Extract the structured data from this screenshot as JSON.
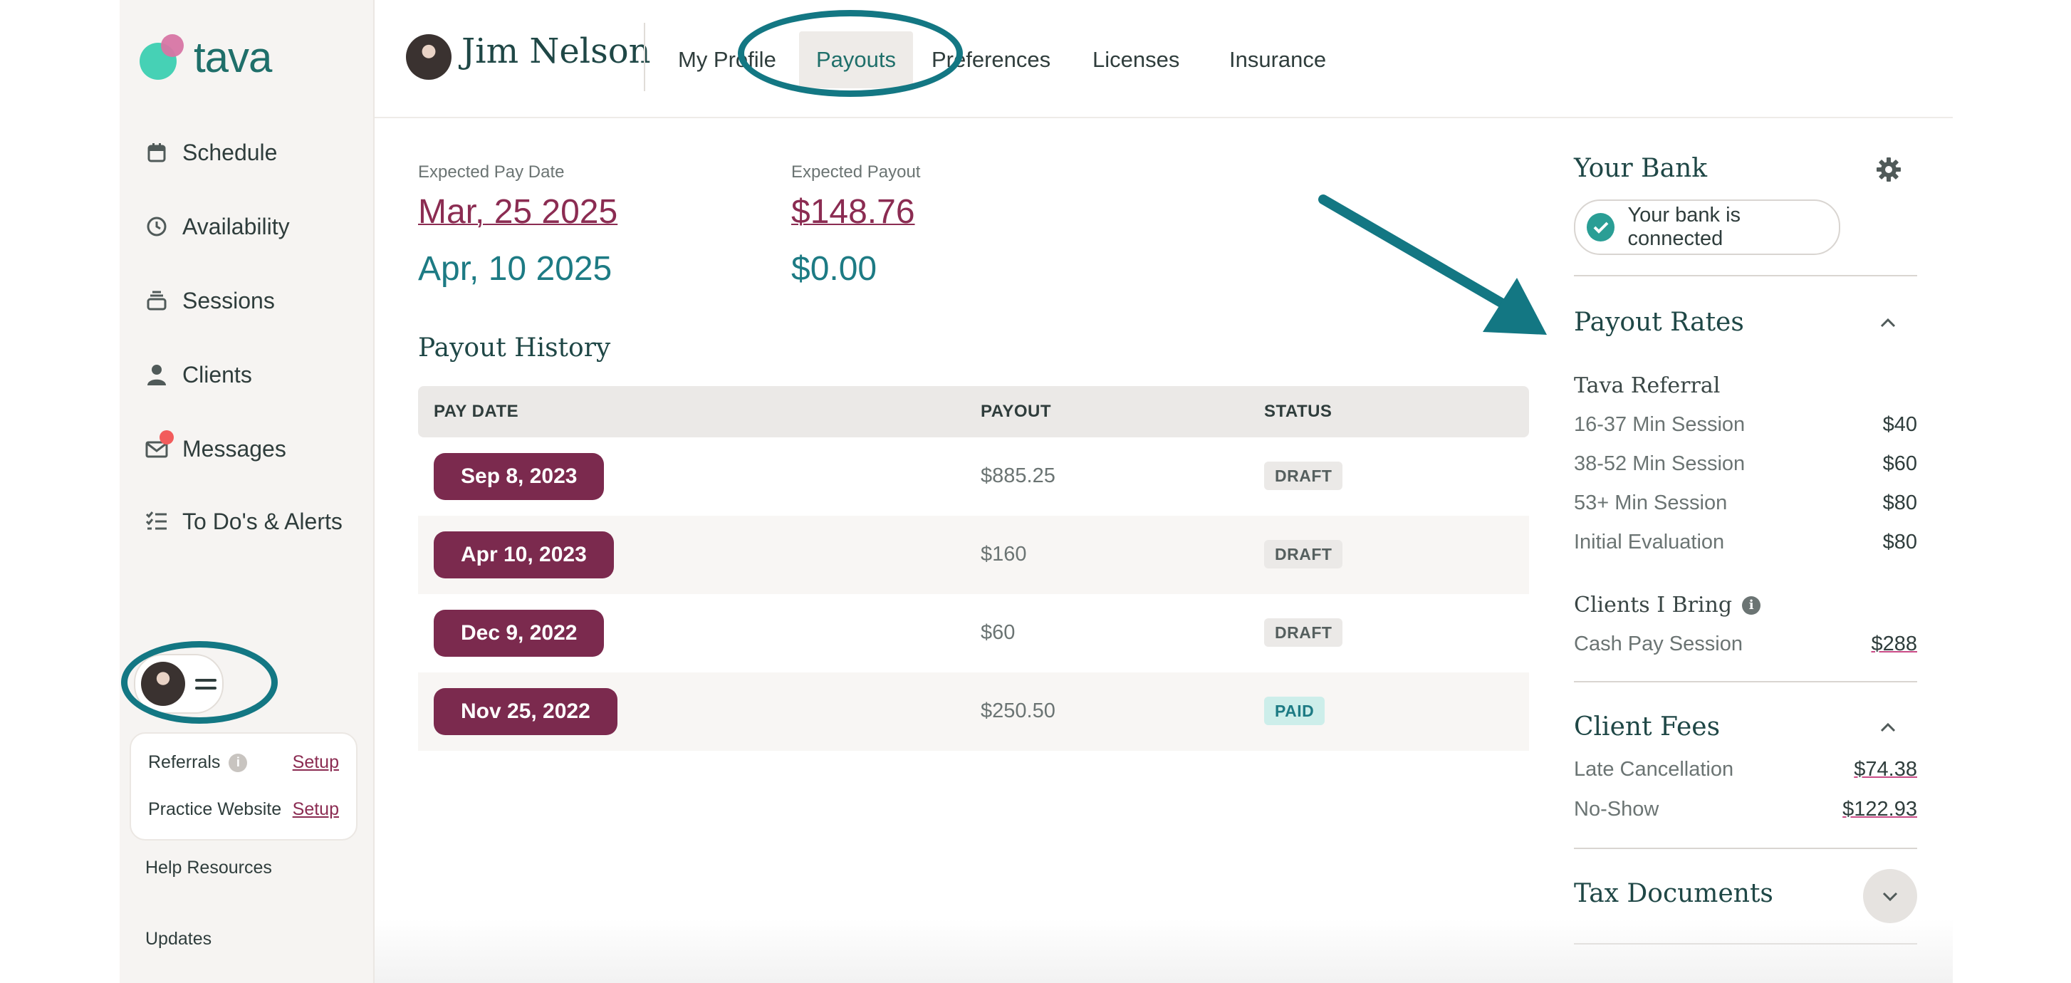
{
  "app": {
    "logo_text": "tava"
  },
  "sidebar": {
    "items": [
      {
        "label": "Schedule",
        "icon": "calendar-icon"
      },
      {
        "label": "Availability",
        "icon": "clock-icon"
      },
      {
        "label": "Sessions",
        "icon": "stack-icon"
      },
      {
        "label": "Clients",
        "icon": "person-icon"
      },
      {
        "label": "Messages",
        "icon": "mail-icon",
        "badge_color": "#f25c5c"
      },
      {
        "label": "To Do's & Alerts",
        "icon": "checklist-icon"
      }
    ],
    "setup": [
      {
        "label": "Referrals",
        "action": "Setup",
        "has_info": true
      },
      {
        "label": "Practice Website",
        "action": "Setup",
        "has_info": false
      }
    ],
    "help": "Help Resources",
    "updates": "Updates"
  },
  "header": {
    "name": "Jim Nelson",
    "tabs": [
      {
        "label": "My Profile",
        "active": false
      },
      {
        "label": "Payouts",
        "active": true
      },
      {
        "label": "Preferences",
        "active": false
      },
      {
        "label": "Licenses",
        "active": false
      },
      {
        "label": "Insurance",
        "active": false
      }
    ]
  },
  "payouts": {
    "date_label": "Expected Pay Date",
    "payout_label": "Expected Payout",
    "upcoming": [
      {
        "date": "Mar, 25 2025",
        "amount": "$148.76"
      },
      {
        "date": "Apr, 10 2025",
        "amount": "$0.00"
      }
    ],
    "history_title": "Payout History",
    "columns": [
      "PAY DATE",
      "PAYOUT",
      "STATUS"
    ],
    "rows": [
      {
        "date": "Sep 8, 2023",
        "amount": "$885.25",
        "status": "DRAFT"
      },
      {
        "date": "Apr 10, 2023",
        "amount": "$160",
        "status": "DRAFT"
      },
      {
        "date": "Dec 9, 2022",
        "amount": "$60",
        "status": "DRAFT"
      },
      {
        "date": "Nov 25, 2022",
        "amount": "$250.50",
        "status": "PAID"
      }
    ]
  },
  "right_panel": {
    "bank_title": "Your Bank",
    "bank_status": "Your bank is connected",
    "rates_title": "Payout Rates",
    "tava_referral_title": "Tava Referral",
    "tava_rates": [
      {
        "label": "16-37 Min Session",
        "value": "$40"
      },
      {
        "label": "38-52 Min Session",
        "value": "$60"
      },
      {
        "label": "53+ Min Session",
        "value": "$80"
      },
      {
        "label": "Initial Evaluation",
        "value": "$80"
      }
    ],
    "clients_bring_title": "Clients I Bring",
    "clients_rates": [
      {
        "label": "Cash Pay Session",
        "value": "$288"
      }
    ],
    "fees_title": "Client Fees",
    "fees": [
      {
        "label": "Late Cancellation",
        "value": "$74.38"
      },
      {
        "label": "No-Show",
        "value": "$122.93"
      }
    ],
    "tax_title": "Tax Documents"
  },
  "colors": {
    "brand_teal": "#1d7b84",
    "accent_plum": "#7b2a4e",
    "annotation": "#137783"
  }
}
